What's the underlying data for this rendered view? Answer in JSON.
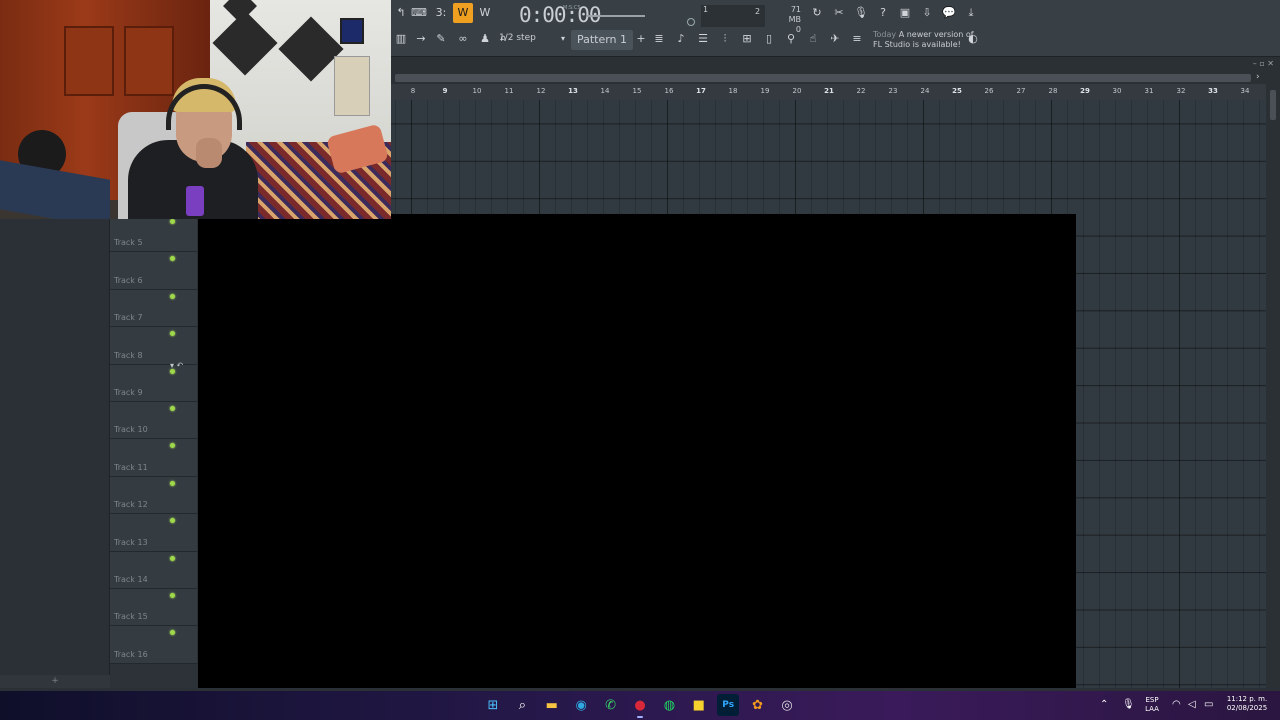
{
  "toolbar": {
    "time": "0:00:00",
    "time_unit": "M:S:CS",
    "cpu_top": "1",
    "cpu_mid": "2",
    "memory": "71 MB",
    "memory_sub": "0",
    "step": "1/2 step",
    "pattern": "Pattern 1",
    "news_date": "Today",
    "news_text_1": "A newer version of",
    "news_text_2": "FL Studio is available!"
  },
  "ruler": {
    "ticks": [
      "8",
      "9",
      "10",
      "11",
      "12",
      "13",
      "14",
      "15",
      "16",
      "17",
      "18",
      "19",
      "20",
      "21",
      "22",
      "23",
      "24",
      "25",
      "26",
      "27",
      "28",
      "29",
      "30",
      "31",
      "32",
      "33",
      "34"
    ]
  },
  "tracks": [
    {
      "label": "Track 5"
    },
    {
      "label": "Track 6"
    },
    {
      "label": "Track 7"
    },
    {
      "label": "Track 8"
    },
    {
      "label": "Track 9"
    },
    {
      "label": "Track 10"
    },
    {
      "label": "Track 11"
    },
    {
      "label": "Track 12"
    },
    {
      "label": "Track 13"
    },
    {
      "label": "Track 14"
    },
    {
      "label": "Track 15"
    },
    {
      "label": "Track 16"
    }
  ],
  "left_panel": {
    "add_label": "+"
  },
  "taskbar": {
    "apps": [
      {
        "name": "start-icon",
        "glyph": "⊞",
        "color": "#4cc2ff"
      },
      {
        "name": "search-icon",
        "glyph": "⌕",
        "color": "#ffffff"
      },
      {
        "name": "file-explorer-icon",
        "glyph": "▬",
        "color": "#f6c343"
      },
      {
        "name": "edge-icon",
        "glyph": "◉",
        "color": "#2fa8e0"
      },
      {
        "name": "whatsapp-icon",
        "glyph": "✆",
        "color": "#37d366"
      },
      {
        "name": "recorder-icon",
        "glyph": "●",
        "color": "#d8283a"
      },
      {
        "name": "spotify-icon",
        "glyph": "◍",
        "color": "#1ed760"
      },
      {
        "name": "sticky-notes-icon",
        "glyph": "■",
        "color": "#f6d22e"
      },
      {
        "name": "photoshop-icon",
        "glyph": "Ps",
        "color": "#31a8ff"
      },
      {
        "name": "fl-studio-icon",
        "glyph": "✿",
        "color": "#f39a1e"
      },
      {
        "name": "obs-icon",
        "glyph": "◎",
        "color": "#dddddd"
      }
    ],
    "language": "ESP",
    "layout": "LAA",
    "time": "11:12 p. m.",
    "date": "02/08/2025"
  }
}
